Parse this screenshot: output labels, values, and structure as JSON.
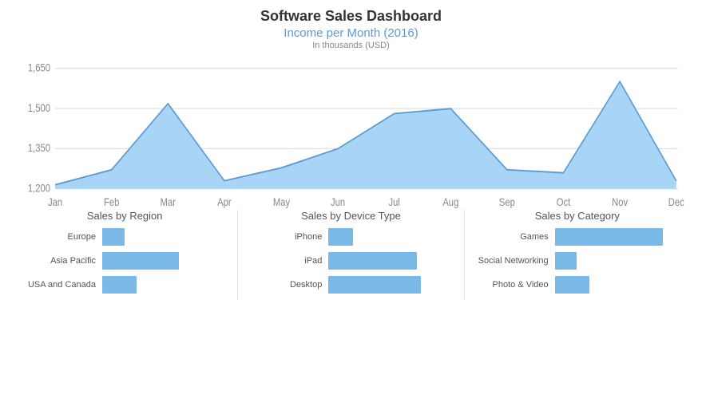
{
  "title": "Software Sales Dashboard",
  "area_chart": {
    "title": "Income per Month (2016)",
    "subtitle": "In thousands (USD)",
    "y_labels": [
      "1,650",
      "1,500",
      "1,350",
      "1,200"
    ],
    "x_labels": [
      "Jan",
      "Feb",
      "Mar",
      "Apr",
      "May",
      "Jun",
      "Jul",
      "Aug",
      "Sep",
      "Oct",
      "Nov",
      "Dec"
    ],
    "accent_color": "#a8d4f5",
    "stroke_color": "#5b9bd5"
  },
  "region_chart": {
    "title": "Sales by Region",
    "bars": [
      {
        "label": "Europe",
        "value": 18,
        "max": 100
      },
      {
        "label": "Asia Pacific",
        "value": 62,
        "max": 100
      },
      {
        "label": "USA and Canada",
        "value": 28,
        "max": 100
      }
    ]
  },
  "device_chart": {
    "title": "Sales by Device Type",
    "bars": [
      {
        "label": "iPhone",
        "value": 20,
        "max": 100
      },
      {
        "label": "iPad",
        "value": 72,
        "max": 100
      },
      {
        "label": "Desktop",
        "value": 75,
        "max": 100
      }
    ]
  },
  "category_chart": {
    "title": "Sales by Category",
    "bars": [
      {
        "label": "Games",
        "value": 88,
        "max": 100
      },
      {
        "label": "Social Networking",
        "value": 18,
        "max": 100
      },
      {
        "label": "Photo & Video",
        "value": 28,
        "max": 100
      }
    ]
  }
}
